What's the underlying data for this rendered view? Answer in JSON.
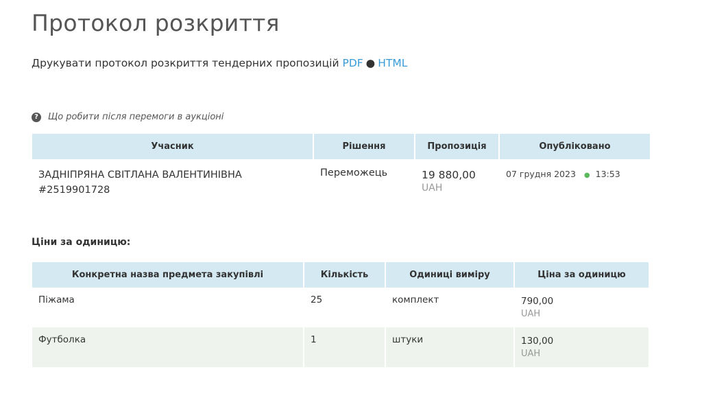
{
  "page": {
    "title": "Протокол розкриття"
  },
  "print": {
    "label": "Друкувати протокол розкриття тендерних пропозицій",
    "pdf_link": "PDF",
    "separator": "●",
    "html_link": "HTML"
  },
  "help": {
    "icon": "question-circle-icon",
    "icon_glyph": "?",
    "text": "Що робити після перемоги в аукціоні"
  },
  "results_table": {
    "headers": {
      "participant": "Учасник",
      "decision": "Рішення",
      "offer": "Пропозиція",
      "published": "Опубліковано"
    },
    "rows": [
      {
        "participant_name": "ЗАДНІПРЯНА СВІТЛАНА ВАЛЕНТИНІВНА",
        "participant_id": "#2519901728",
        "decision": "Переможець",
        "offer_amount": "19 880,00",
        "offer_currency": "UAH",
        "published_date": "07 грудня 2023",
        "published_dot": "●",
        "published_time": "13:53"
      }
    ]
  },
  "unit_prices": {
    "heading": "Ціни за одиницю:",
    "headers": {
      "item_name": "Конкретна назва предмета закупівлі",
      "quantity": "Кількість",
      "unit": "Одиниці виміру",
      "unit_price": "Ціна за одиницю"
    },
    "rows": [
      {
        "item_name": "Піжама",
        "quantity": "25",
        "unit": "комплект",
        "price": "790,00",
        "currency": "UAH"
      },
      {
        "item_name": "Футболка",
        "quantity": "1",
        "unit": "штуки",
        "price": "130,00",
        "currency": "UAH"
      }
    ]
  },
  "colors": {
    "link": "#3a9bd9",
    "header_bg": "#d4e9f2",
    "alt_row_bg": "#eef3ee",
    "muted_text": "#999999",
    "status_dot": "#5cb85c"
  }
}
